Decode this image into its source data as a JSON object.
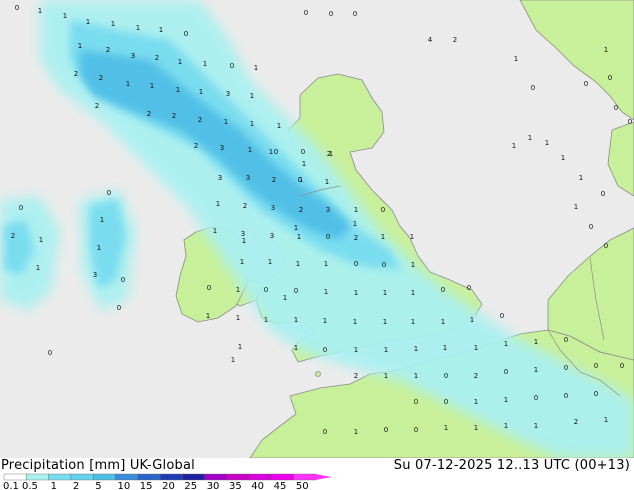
{
  "header": {
    "product_label": "Precipitation [mm]",
    "model_label": "UK-Global",
    "valid_time": "Su 07-12-2025 12..13 UTC (00+13)"
  },
  "colors": {
    "sea": "#ebebeb",
    "land": "#c8f09b",
    "border": "#8a8a8a",
    "rain_light": "#aaf0f0",
    "rain_mid": "#78dcf0",
    "rain_heavy": "#50bee6"
  },
  "legend": {
    "ticks": [
      "0.1",
      "0.5",
      "1",
      "2",
      "5",
      "10",
      "15",
      "20",
      "25",
      "30",
      "35",
      "40",
      "45",
      "50"
    ],
    "colors": [
      "#ffffff",
      "#aaf0f0",
      "#78dcf0",
      "#64d2eb",
      "#50bee6",
      "#3c8cdc",
      "#2864c8",
      "#1e3cb4",
      "#1e1ea0",
      "#a000c8",
      "#c800c8",
      "#dc00dc",
      "#f000f0",
      "#ff32ff"
    ]
  },
  "precip_values": [
    "0",
    "1",
    "1",
    "1",
    "1",
    "1",
    "1",
    "0",
    "0",
    "0",
    "0",
    "1",
    "2",
    "3",
    "2",
    "1",
    "1",
    "0",
    "1",
    "4",
    "2",
    "2",
    "2",
    "1",
    "1",
    "1",
    "1",
    "3",
    "1",
    "2",
    "2",
    "2",
    "2",
    "1",
    "1",
    "1",
    "2",
    "3",
    "1",
    "0",
    "0",
    "1",
    "3",
    "3",
    "2",
    "1",
    "1",
    "1",
    "2",
    "3",
    "2",
    "3",
    "1",
    "0",
    "1",
    "2",
    "3",
    "3",
    "1",
    "0",
    "2",
    "1",
    "1",
    "1",
    "1",
    "1",
    "1",
    "1",
    "0",
    "0",
    "1",
    "3",
    "0",
    "0",
    "1",
    "0",
    "0",
    "1",
    "1",
    "1",
    "1",
    "0",
    "0",
    "0",
    "1",
    "1",
    "1",
    "1",
    "1",
    "1",
    "1",
    "1",
    "1",
    "1",
    "0",
    "0",
    "1",
    "0",
    "1",
    "1",
    "1",
    "1",
    "1",
    "1",
    "1",
    "0",
    "2",
    "1",
    "1",
    "0",
    "2",
    "0",
    "1",
    "0",
    "0",
    "0",
    "0",
    "0",
    "1",
    "1",
    "0",
    "0",
    "0",
    "0",
    "1",
    "0",
    "0",
    "1",
    "1",
    "1",
    "1",
    "2",
    "1",
    "0",
    "0",
    "0",
    "1",
    "0",
    "0",
    "0",
    "1",
    "1",
    "1",
    "2",
    "1",
    "1",
    "0",
    "0",
    "1",
    "1",
    "1",
    "0",
    "1",
    "1",
    "1",
    "1",
    "1",
    "1",
    "1",
    "1",
    "1",
    "1",
    "0",
    "0"
  ]
}
